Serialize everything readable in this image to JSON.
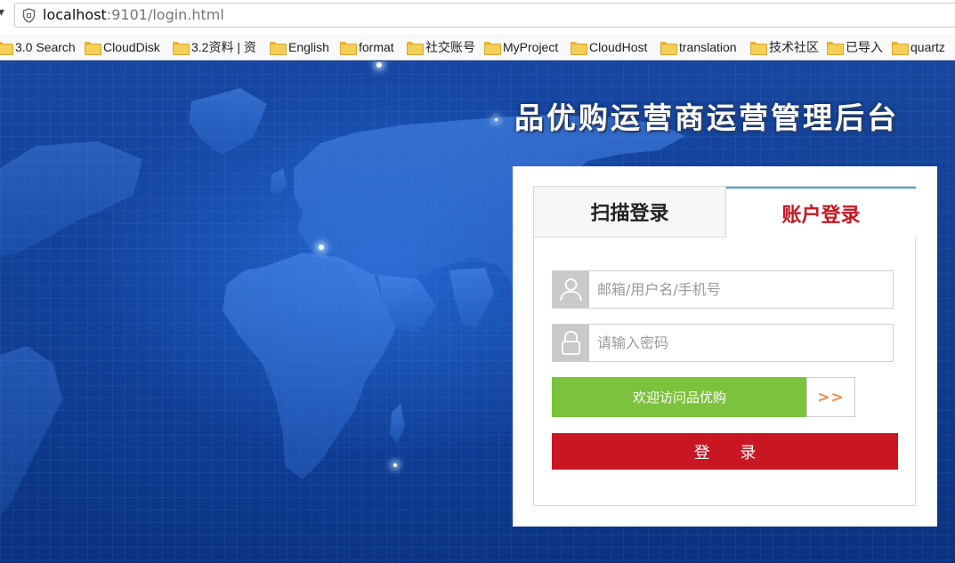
{
  "address_bar": {
    "host": "localhost",
    "path": ":9101/login.html"
  },
  "bookmarks": [
    {
      "label": "3.0 Search"
    },
    {
      "label": "CloudDisk"
    },
    {
      "label": "3.2资料 | 资"
    },
    {
      "label": "English"
    },
    {
      "label": "format"
    },
    {
      "label": "社交账号"
    },
    {
      "label": "MyProject"
    },
    {
      "label": "CloudHost"
    },
    {
      "label": "translation"
    },
    {
      "label": "技术社区"
    },
    {
      "label": "已导入"
    },
    {
      "label": "quartz"
    }
  ],
  "page": {
    "title": "品优购运营商运营管理后台"
  },
  "login": {
    "tabs": [
      {
        "label": "扫描登录",
        "active": false
      },
      {
        "label": "账户登录",
        "active": true
      }
    ],
    "username_placeholder": "邮箱/用户名/手机号",
    "password_placeholder": "请输入密码",
    "slider_text": "欢迎访问品优购",
    "slider_handle": ">>",
    "submit_label": "登 录"
  },
  "colors": {
    "brand_red": "#c81623",
    "slider_green": "#7cc23c",
    "background_blue": "#0f3d8f"
  },
  "icons": {
    "address_bar": "shield-icon",
    "bookmark": "folder-icon",
    "username": "user-icon",
    "password": "lock-icon"
  }
}
